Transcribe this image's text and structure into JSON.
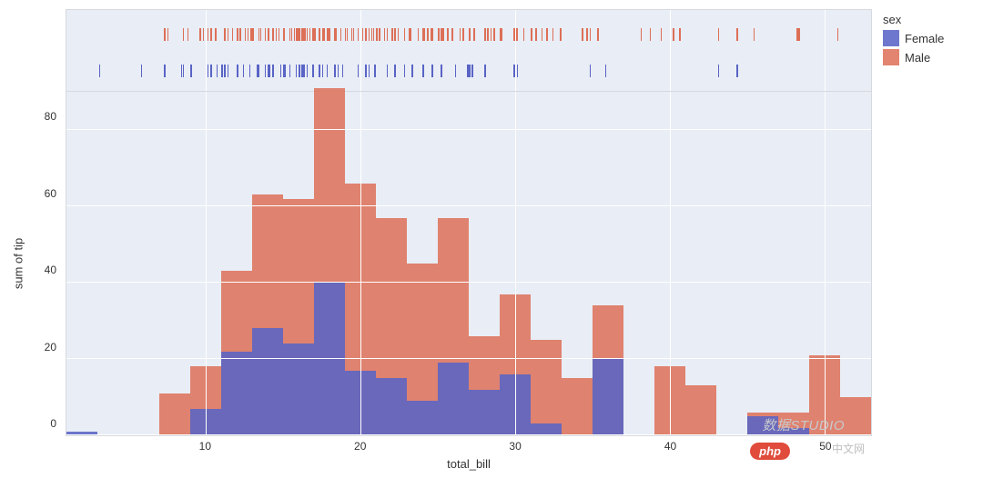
{
  "legend": {
    "title": "sex",
    "items": [
      {
        "label": "Female",
        "color": "#5964c6"
      },
      {
        "label": "Male",
        "color": "#dd6f57"
      }
    ]
  },
  "axes": {
    "ylabel": "sum of tip",
    "xlabel": "total_bill",
    "y_ticks": [
      0,
      20,
      40,
      60,
      80
    ],
    "x_ticks": [
      10,
      20,
      30,
      40,
      50
    ]
  },
  "watermarks": {
    "studio": "数据STUDIO",
    "php": "php",
    "cn": "中文网"
  },
  "chart_data": {
    "type": "bar",
    "title": "",
    "xlabel": "total_bill",
    "ylabel": "sum of tip",
    "ylim": [
      0,
      90
    ],
    "xlim": [
      1,
      53
    ],
    "bin_width": 2,
    "bin_centers": [
      2,
      4,
      6,
      8,
      10,
      12,
      14,
      16,
      18,
      20,
      22,
      24,
      26,
      28,
      30,
      32,
      34,
      36,
      38,
      40,
      42,
      44,
      46,
      48,
      50,
      52
    ],
    "series": [
      {
        "name": "Female",
        "color": "#5964c6",
        "values": [
          1,
          0,
          0,
          0,
          7,
          22,
          28,
          24,
          40,
          17,
          15,
          9,
          19,
          12,
          16,
          3,
          0,
          20,
          0,
          0,
          0,
          0,
          5,
          2,
          0,
          0
        ]
      },
      {
        "name": "Male",
        "color": "#dd6f57",
        "values": [
          0,
          0,
          0,
          11,
          18,
          43,
          63,
          62,
          91,
          66,
          57,
          45,
          57,
          26,
          37,
          25,
          15,
          34,
          0,
          18,
          13,
          0,
          6,
          6,
          21,
          10
        ]
      }
    ],
    "rug_marginal": {
      "axis": "x",
      "Male": [
        7.3,
        7.5,
        8.5,
        8.8,
        9.6,
        9.8,
        10.1,
        10.3,
        10.3,
        10.3,
        10.6,
        11.2,
        11.4,
        11.7,
        12,
        12.2,
        12.5,
        12.5,
        12.7,
        12.9,
        13,
        13,
        13.4,
        13.4,
        13.5,
        13.8,
        14,
        14,
        14.3,
        14.5,
        14.7,
        15,
        15,
        15.4,
        15.5,
        15.7,
        15.8,
        15.9,
        16,
        16.2,
        16.3,
        16.4,
        16.5,
        16.7,
        16.9,
        17,
        17.3,
        17.5,
        17.6,
        17.8,
        17.9,
        18,
        18.3,
        18.4,
        18.7,
        19,
        19.1,
        19.4,
        19.5,
        19.8,
        20,
        20.1,
        20.3,
        20.5,
        20.7,
        20.8,
        21,
        21,
        21.2,
        21.5,
        21.7,
        22,
        22.2,
        22.4,
        22.8,
        23.1,
        23.2,
        23.7,
        24,
        24.1,
        24.3,
        24.5,
        24.6,
        25,
        25.2,
        25.3,
        25.6,
        25.9,
        26.4,
        26.6,
        27,
        27.3,
        28,
        28.2,
        28.4,
        28.6,
        29,
        29.1,
        29.9,
        30,
        30.1,
        30.5,
        31,
        31.3,
        31.7,
        32,
        32.4,
        32.9,
        34.3,
        34.6,
        34.8,
        35.3,
        38.1,
        38.7,
        39.4,
        40.2,
        40.6,
        43.1,
        44.3,
        45.4,
        48.2,
        48.3,
        48.3,
        50.8
      ],
      "Female": [
        3.1,
        5.8,
        7.3,
        8.4,
        8.5,
        9.0,
        10.1,
        10.3,
        10.7,
        11,
        11.2,
        11.4,
        12,
        12.4,
        12.8,
        13.3,
        13.4,
        13.4,
        13.8,
        14,
        14.1,
        14.3,
        14.8,
        15,
        15.1,
        15.4,
        15.8,
        16,
        16.2,
        16.3,
        16.5,
        16.9,
        17.3,
        17.5,
        17.8,
        18.3,
        18.5,
        18.8,
        19.8,
        20,
        20.3,
        20.5,
        20.9,
        21.7,
        22.2,
        22.8,
        23.3,
        24,
        24.6,
        25.2,
        26.1,
        26.9,
        27,
        27.2,
        28,
        29.9,
        30.1,
        34.8,
        35.8,
        43.1,
        44.3
      ]
    }
  }
}
